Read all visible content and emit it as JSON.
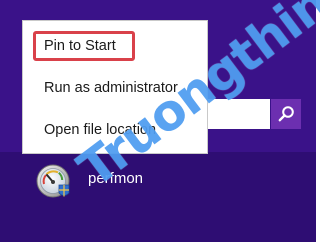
{
  "context_menu": {
    "items": [
      {
        "label": "Pin to Start",
        "highlighted": true
      },
      {
        "label": "Run as administrator",
        "highlighted": false
      },
      {
        "label": "Open file location",
        "highlighted": false
      }
    ],
    "highlight_color": "#d9414a"
  },
  "search": {
    "value": "",
    "button_icon": "search-icon",
    "button_color": "#6c2fb0"
  },
  "app_result": {
    "label": "perfmon",
    "icon": "performance-monitor-icon"
  },
  "watermark": {
    "text": "Truongthin.top",
    "color": "#4396ef"
  },
  "colors": {
    "background": "#2e0d73",
    "accent": "#3a1289"
  }
}
